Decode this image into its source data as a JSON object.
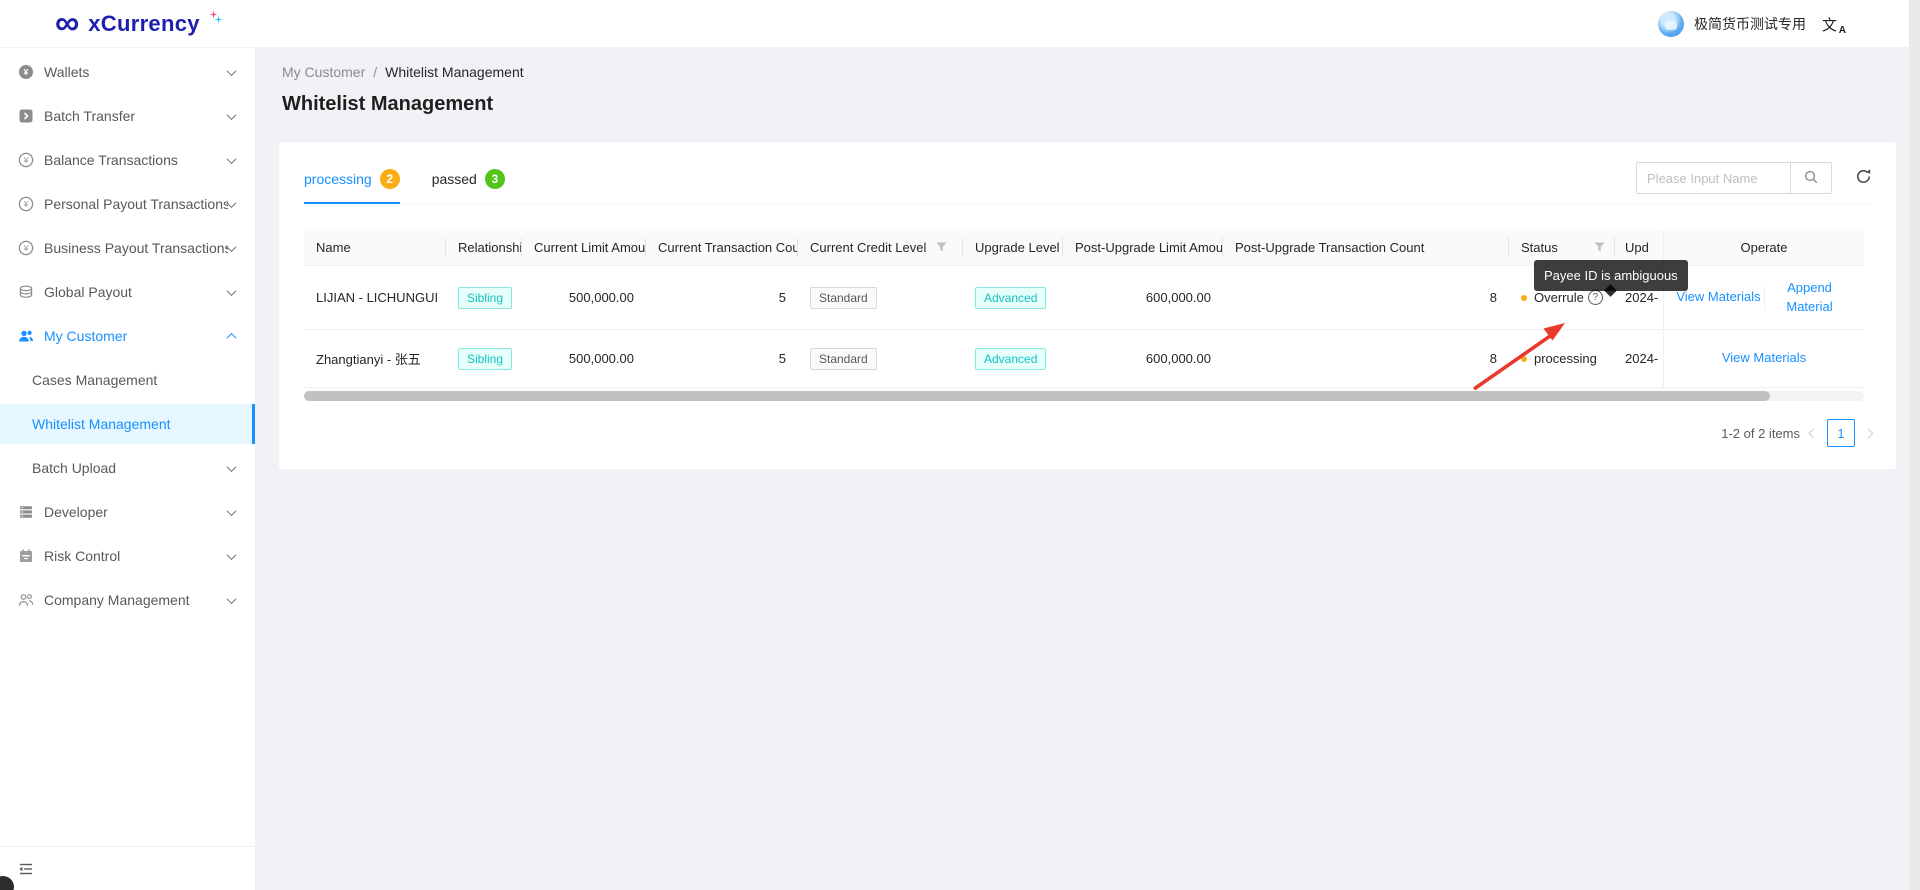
{
  "colors": {
    "accent": "#1890ff",
    "processing_badge": "#faad14",
    "passed_badge": "#52c41a",
    "status_dot": "#faad14",
    "link": "#1890ff",
    "annotation_arrow": "#e8392b"
  },
  "brand": {
    "logo_symbol": "∞",
    "logo_text": "xCurrency"
  },
  "header": {
    "username": "极简货币测试专用",
    "translate_primary": "文",
    "translate_secondary": "A"
  },
  "sidebar": {
    "items": [
      {
        "label": "Wallets",
        "icon": "wallet-icon"
      },
      {
        "label": "Batch Transfer",
        "icon": "batch-transfer-icon"
      },
      {
        "label": "Balance Transactions",
        "icon": "balance-transactions-icon"
      },
      {
        "label": "Personal Payout Transactions",
        "icon": "personal-payout-icon"
      },
      {
        "label": "Business Payout Transactions",
        "icon": "business-payout-icon"
      },
      {
        "label": "Global Payout",
        "icon": "global-payout-icon"
      },
      {
        "label": "My Customer",
        "icon": "my-customer-icon"
      },
      {
        "label": "Cases Management"
      },
      {
        "label": "Whitelist Management"
      },
      {
        "label": "Batch Upload"
      },
      {
        "label": "Developer",
        "icon": "developer-icon"
      },
      {
        "label": "Risk Control",
        "icon": "risk-control-icon"
      },
      {
        "label": "Company Management",
        "icon": "company-management-icon"
      }
    ]
  },
  "breadcrumb": {
    "parent": "My Customer",
    "separator": "/",
    "current": "Whitelist Management"
  },
  "page": {
    "title": "Whitelist Management"
  },
  "tabs": [
    {
      "label": "processing",
      "count": "2"
    },
    {
      "label": "passed",
      "count": "3"
    }
  ],
  "search": {
    "placeholder": "Please Input Name"
  },
  "table": {
    "columns": [
      "Name",
      "Relationship",
      "Current Limit Amount",
      "Current Transaction Count",
      "Current Credit Level",
      "Upgrade Level",
      "Post-Upgrade Limit Amount",
      "Post-Upgrade Transaction Count",
      "Status",
      "Upd",
      "Operate"
    ],
    "rows": [
      {
        "name": "LIJIAN - LICHUNGUI",
        "relationship": "Sibling",
        "current_limit_amount": "500,000.00",
        "current_transaction_count": "5",
        "current_credit_level": "Standard",
        "upgrade_level": "Advanced",
        "post_upgrade_limit_amount": "600,000.00",
        "post_upgrade_transaction_count": "8",
        "status": "Overrule",
        "update_time": "2024-",
        "actions": [
          "View Materials",
          "Append Material"
        ]
      },
      {
        "name": "Zhangtianyi - 张五",
        "relationship": "Sibling",
        "current_limit_amount": "500,000.00",
        "current_transaction_count": "5",
        "current_credit_level": "Standard",
        "upgrade_level": "Advanced",
        "post_upgrade_limit_amount": "600,000.00",
        "post_upgrade_transaction_count": "8",
        "status": "processing",
        "update_time": "2024-",
        "actions": [
          "View Materials"
        ]
      }
    ]
  },
  "tooltip": {
    "text": "Payee ID is ambiguous"
  },
  "pagination": {
    "summary": "1-2 of 2 items",
    "current_page": "1"
  }
}
